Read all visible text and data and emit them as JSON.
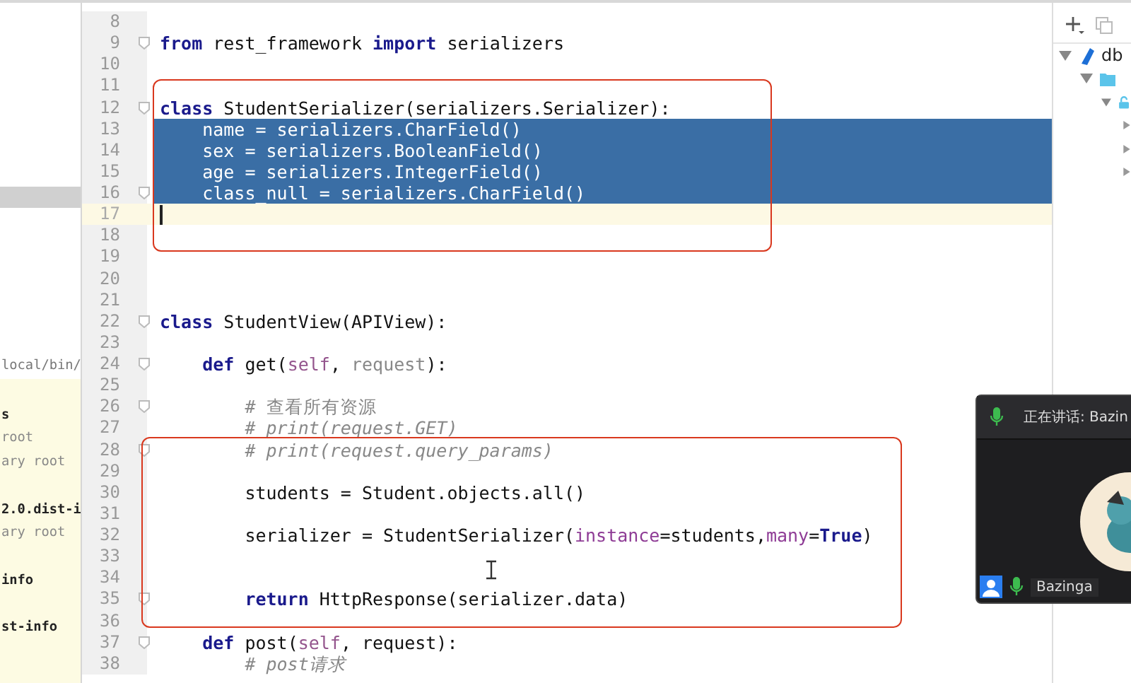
{
  "project_panel": {
    "items": [
      {
        "text": "local/bin/",
        "kind": "path"
      },
      {
        "text": "s",
        "kind": "module"
      },
      {
        "text": "root",
        "kind": "note"
      },
      {
        "text": "ary root",
        "kind": "note"
      },
      {
        "text": "2.0.dist-i",
        "kind": "module"
      },
      {
        "text": "ary root",
        "kind": "note"
      },
      {
        "text": "info",
        "kind": "module"
      },
      {
        "text": "st-info",
        "kind": "module"
      }
    ]
  },
  "editor": {
    "lines": [
      {
        "number": "8",
        "fold": false,
        "selected": false,
        "current": false
      },
      {
        "number": "9",
        "fold": true,
        "selected": false,
        "current": false,
        "tokens": [
          {
            "text": "from",
            "kind": "keyword"
          },
          {
            "text": " rest_framework ",
            "kind": "plain"
          },
          {
            "text": "import",
            "kind": "keyword"
          },
          {
            "text": " serializers",
            "kind": "plain"
          }
        ]
      },
      {
        "number": "10",
        "fold": false,
        "selected": false,
        "current": false
      },
      {
        "number": "11",
        "fold": false,
        "selected": false,
        "current": false
      },
      {
        "number": "12",
        "fold": true,
        "selected": false,
        "current": false,
        "tokens": [
          {
            "text": "class",
            "kind": "keyword"
          },
          {
            "text": " StudentSerializer(serializers.Serializer):",
            "kind": "plain"
          }
        ]
      },
      {
        "number": "13",
        "fold": false,
        "selected": true,
        "current": false,
        "tokens": [
          {
            "text": "    name = serializers.CharField()",
            "kind": "plain"
          }
        ]
      },
      {
        "number": "14",
        "fold": false,
        "selected": true,
        "current": false,
        "tokens": [
          {
            "text": "    sex = serializers.BooleanField()",
            "kind": "plain"
          }
        ]
      },
      {
        "number": "15",
        "fold": false,
        "selected": true,
        "current": false,
        "tokens": [
          {
            "text": "    age = serializers.IntegerField()",
            "kind": "plain"
          }
        ]
      },
      {
        "number": "16",
        "fold": true,
        "selected": true,
        "current": false,
        "tokens": [
          {
            "text": "    class_null = serializers.CharField()",
            "kind": "plain"
          }
        ]
      },
      {
        "number": "17",
        "fold": false,
        "selected": false,
        "current": true
      },
      {
        "number": "18",
        "fold": false,
        "selected": false,
        "current": false
      },
      {
        "number": "19",
        "fold": false,
        "selected": false,
        "current": false
      },
      {
        "number": "20",
        "fold": false,
        "selected": false,
        "current": false
      },
      {
        "number": "21",
        "fold": false,
        "selected": false,
        "current": false
      },
      {
        "number": "22",
        "fold": true,
        "selected": false,
        "current": false,
        "tokens": [
          {
            "text": "class",
            "kind": "keyword"
          },
          {
            "text": " StudentView(APIView):",
            "kind": "plain"
          }
        ]
      },
      {
        "number": "23",
        "fold": false,
        "selected": false,
        "current": false
      },
      {
        "number": "24",
        "fold": true,
        "selected": false,
        "current": false,
        "tokens": [
          {
            "text": "    def",
            "kind": "keyword"
          },
          {
            "text": " get(",
            "kind": "plain"
          },
          {
            "text": "self",
            "kind": "self"
          },
          {
            "text": ", ",
            "kind": "plain"
          },
          {
            "text": "request",
            "kind": "unused"
          },
          {
            "text": "):",
            "kind": "plain"
          }
        ]
      },
      {
        "number": "25",
        "fold": false,
        "selected": false,
        "current": false
      },
      {
        "number": "26",
        "fold": true,
        "selected": false,
        "current": false,
        "tokens": [
          {
            "text": "        # 查看所有资源",
            "kind": "comment"
          }
        ]
      },
      {
        "number": "27",
        "fold": false,
        "selected": false,
        "current": false,
        "tokens": [
          {
            "text": "        # print(request.GET)",
            "kind": "comment-italic"
          }
        ]
      },
      {
        "number": "28",
        "fold": true,
        "selected": false,
        "current": false,
        "tokens": [
          {
            "text": "        # print(request.query_params)",
            "kind": "comment-italic"
          }
        ]
      },
      {
        "number": "29",
        "fold": false,
        "selected": false,
        "current": false
      },
      {
        "number": "30",
        "fold": false,
        "selected": false,
        "current": false,
        "tokens": [
          {
            "text": "        students = Student.objects.all()",
            "kind": "plain"
          }
        ]
      },
      {
        "number": "31",
        "fold": false,
        "selected": false,
        "current": false
      },
      {
        "number": "32",
        "fold": false,
        "selected": false,
        "current": false,
        "tokens": [
          {
            "text": "        serializer = StudentSerializer(",
            "kind": "plain"
          },
          {
            "text": "instance",
            "kind": "kwarg"
          },
          {
            "text": "=students,",
            "kind": "plain"
          },
          {
            "text": "many",
            "kind": "kwarg"
          },
          {
            "text": "=",
            "kind": "plain"
          },
          {
            "text": "True",
            "kind": "keyword"
          },
          {
            "text": ")",
            "kind": "plain"
          }
        ]
      },
      {
        "number": "33",
        "fold": false,
        "selected": false,
        "current": false
      },
      {
        "number": "34",
        "fold": false,
        "selected": false,
        "current": false
      },
      {
        "number": "35",
        "fold": true,
        "selected": false,
        "current": false,
        "tokens": [
          {
            "text": "        return",
            "kind": "keyword"
          },
          {
            "text": " HttpResponse(serializer.data)",
            "kind": "plain"
          }
        ]
      },
      {
        "number": "36",
        "fold": false,
        "selected": false,
        "current": false
      },
      {
        "number": "37",
        "fold": true,
        "selected": false,
        "current": false,
        "tokens": [
          {
            "text": "    def",
            "kind": "keyword"
          },
          {
            "text": " post(",
            "kind": "plain"
          },
          {
            "text": "self",
            "kind": "self"
          },
          {
            "text": ", request):",
            "kind": "plain"
          }
        ]
      },
      {
        "number": "38",
        "fold": false,
        "selected": false,
        "current": false,
        "tokens": [
          {
            "text": "        # post请求",
            "kind": "comment-italic"
          }
        ]
      }
    ]
  },
  "database_panel": {
    "tree": [
      {
        "label": "db",
        "kind": "database",
        "expanded": true,
        "children": [
          {
            "kind": "folder",
            "expanded": true,
            "children": [
              {
                "kind": "schema",
                "expanded": true,
                "children": [
                  {
                    "expanded": false
                  },
                  {
                    "expanded": false
                  },
                  {
                    "expanded": false
                  }
                ]
              }
            ]
          }
        ]
      }
    ]
  },
  "video_call": {
    "speaking_label": "正在讲话: Bazin",
    "participant": "Bazinga"
  }
}
